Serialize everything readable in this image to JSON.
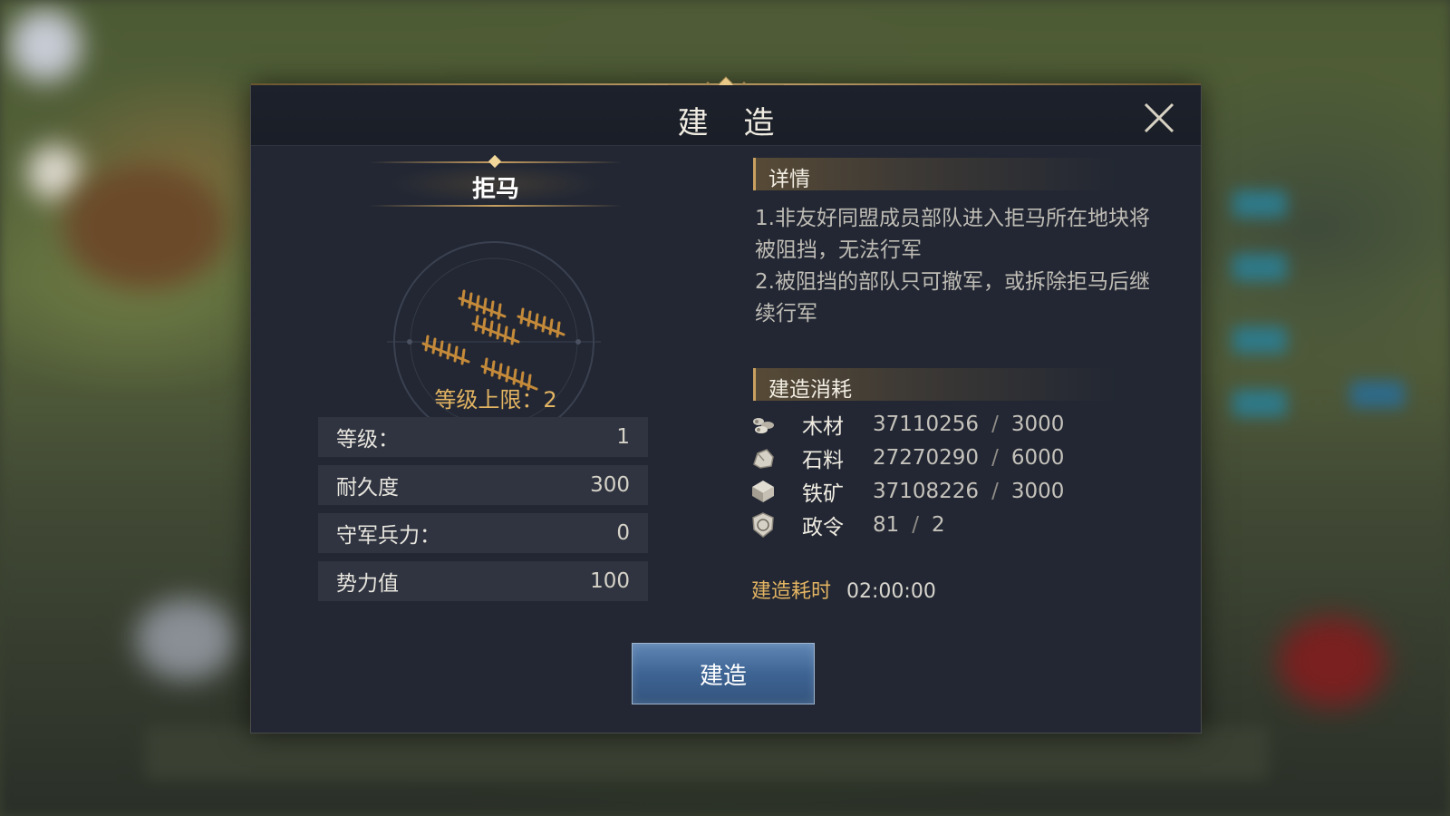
{
  "dialog": {
    "title": "建 造",
    "close_icon": "close-icon"
  },
  "building": {
    "name": "拒马",
    "level_cap": "等级上限：2",
    "stats": [
      {
        "label": "等级：",
        "value": "1"
      },
      {
        "label": "耐久度",
        "value": "300"
      },
      {
        "label": "守军兵力：",
        "value": "0"
      },
      {
        "label": "势力值",
        "value": "100"
      }
    ]
  },
  "details": {
    "heading": "详情",
    "lines": [
      "1.非友好同盟成员部队进入拒马所在地块将被阻挡，无法行军",
      "2.被阻挡的部队只可撤军，或拆除拒马后继续行军"
    ]
  },
  "cost": {
    "heading": "建造消耗",
    "items": [
      {
        "icon": "wood-icon",
        "label": "木材",
        "have": "37110256",
        "sep": "/",
        "need": "3000"
      },
      {
        "icon": "stone-icon",
        "label": "石料",
        "have": "27270290",
        "sep": "/",
        "need": "6000"
      },
      {
        "icon": "iron-ore-icon",
        "label": "铁矿",
        "have": "37108226",
        "sep": "/",
        "need": "3000"
      },
      {
        "icon": "decree-icon",
        "label": "政令",
        "have": "81",
        "sep": "/",
        "need": "2"
      }
    ],
    "time_label": "建造耗时",
    "time_value": "02:00:00"
  },
  "actions": {
    "build_label": "建造"
  },
  "colors": {
    "accent_gold": "#e3b462",
    "button_blue": "#3e6494",
    "panel_bg": "#222733"
  }
}
